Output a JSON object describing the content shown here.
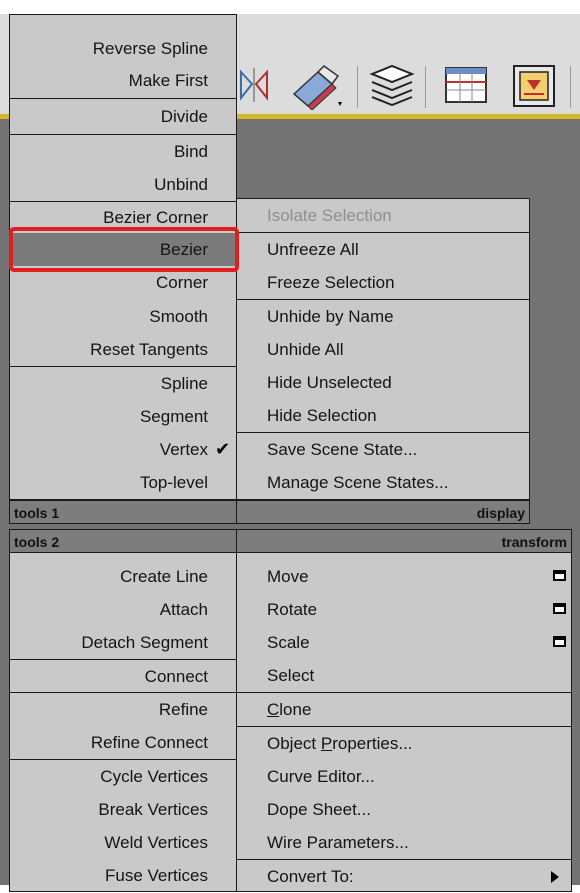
{
  "upper_left_menu": {
    "items": [
      {
        "label": "Reverse Spline"
      },
      {
        "label": "Make First"
      },
      {
        "label": "Divide"
      },
      {
        "label": "Bind"
      },
      {
        "label": "Unbind"
      },
      {
        "label": "Bezier Corner"
      },
      {
        "label": "Bezier",
        "highlighted": true
      },
      {
        "label": "Corner"
      },
      {
        "label": "Smooth"
      },
      {
        "label": "Reset Tangents"
      },
      {
        "label": "Spline"
      },
      {
        "label": "Segment"
      },
      {
        "label": "Vertex",
        "checked": true
      },
      {
        "label": "Top-level"
      }
    ],
    "title": "tools 1"
  },
  "upper_right_menu": {
    "items": [
      {
        "label": "Isolate Selection",
        "disabled": true
      },
      {
        "label": "Unfreeze All"
      },
      {
        "label": "Freeze Selection"
      },
      {
        "label": "Unhide by Name"
      },
      {
        "label": "Unhide All"
      },
      {
        "label": "Hide Unselected"
      },
      {
        "label": "Hide Selection"
      },
      {
        "label": "Save Scene State..."
      },
      {
        "label": "Manage Scene States..."
      }
    ],
    "title": "display"
  },
  "lower_left_menu": {
    "title": "tools 2",
    "items": [
      {
        "label": "Create Line"
      },
      {
        "label": "Attach"
      },
      {
        "label": "Detach Segment"
      },
      {
        "label": "Connect"
      },
      {
        "label": "Refine"
      },
      {
        "label": "Refine Connect"
      },
      {
        "label": "Cycle Vertices"
      },
      {
        "label": "Break Vertices"
      },
      {
        "label": "Weld Vertices"
      },
      {
        "label": "Fuse Vertices"
      }
    ]
  },
  "lower_right_menu": {
    "title": "transform",
    "items": [
      {
        "label": "Move",
        "has_settings": true
      },
      {
        "label": "Rotate",
        "has_settings": true
      },
      {
        "label": "Scale",
        "has_settings": true
      },
      {
        "label": "Select"
      },
      {
        "label": "Clone"
      },
      {
        "label": "Object Properties..."
      },
      {
        "label": "Curve Editor..."
      },
      {
        "label": "Dope Sheet..."
      },
      {
        "label": "Wire Parameters..."
      },
      {
        "label": "Convert To:",
        "has_submenu": true
      }
    ]
  },
  "colors": {
    "menu_bg": "#c9c9c9",
    "highlight_bg": "#7b7b7b",
    "title_bg": "#7d7d7d",
    "red_callout": "#e01e1e",
    "toolbar_accent": "#d8b728"
  },
  "icons": [
    "mirror-icon",
    "align-icon",
    "layers-icon",
    "curve-editor-icon",
    "schematic-view-icon"
  ]
}
